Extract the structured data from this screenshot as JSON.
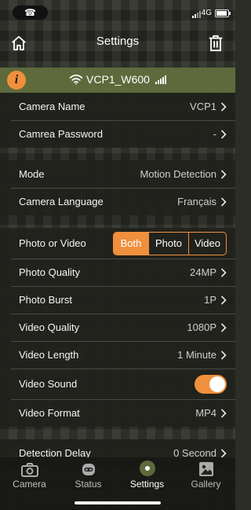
{
  "status_bar": {
    "call_glyph": "☎",
    "network": "4G"
  },
  "header": {
    "title": "Settings"
  },
  "wifi": {
    "info_glyph": "i",
    "ssid": "VCP1_W600"
  },
  "groups": {
    "camera": {
      "name_label": "Camera Name",
      "name_value": "VCP1",
      "password_label": "Camrea Password",
      "password_value": "-"
    },
    "system": {
      "mode_label": "Mode",
      "mode_value": "Motion Detection",
      "language_label": "Camera Language",
      "language_value": "Français"
    },
    "capture": {
      "photo_or_video_label": "Photo or Video",
      "photo_or_video_options": [
        "Both",
        "Photo",
        "Video"
      ],
      "photo_or_video_selected": "Both",
      "photo_quality_label": "Photo Quality",
      "photo_quality_value": "24MP",
      "photo_burst_label": "Photo Burst",
      "photo_burst_value": "1P",
      "video_quality_label": "Video Quality",
      "video_quality_value": "1080P",
      "video_length_label": "Video Length",
      "video_length_value": "1 Minute",
      "video_sound_label": "Video Sound",
      "video_sound_on": true,
      "video_format_label": "Video Format",
      "video_format_value": "MP4"
    },
    "detection": {
      "delay_label": "Detection Delay",
      "delay_value": "0 Second"
    }
  },
  "tabs": [
    {
      "label": "Camera",
      "icon": "camera-icon",
      "active": false
    },
    {
      "label": "Status",
      "icon": "robot-icon",
      "active": false
    },
    {
      "label": "Settings",
      "icon": "settings-dot-icon",
      "active": true
    },
    {
      "label": "Gallery",
      "icon": "gallery-icon",
      "active": false
    }
  ],
  "colors": {
    "accent": "#f0903c",
    "wifi_band": "#5e6a3c",
    "row_bg": "#20211c"
  }
}
